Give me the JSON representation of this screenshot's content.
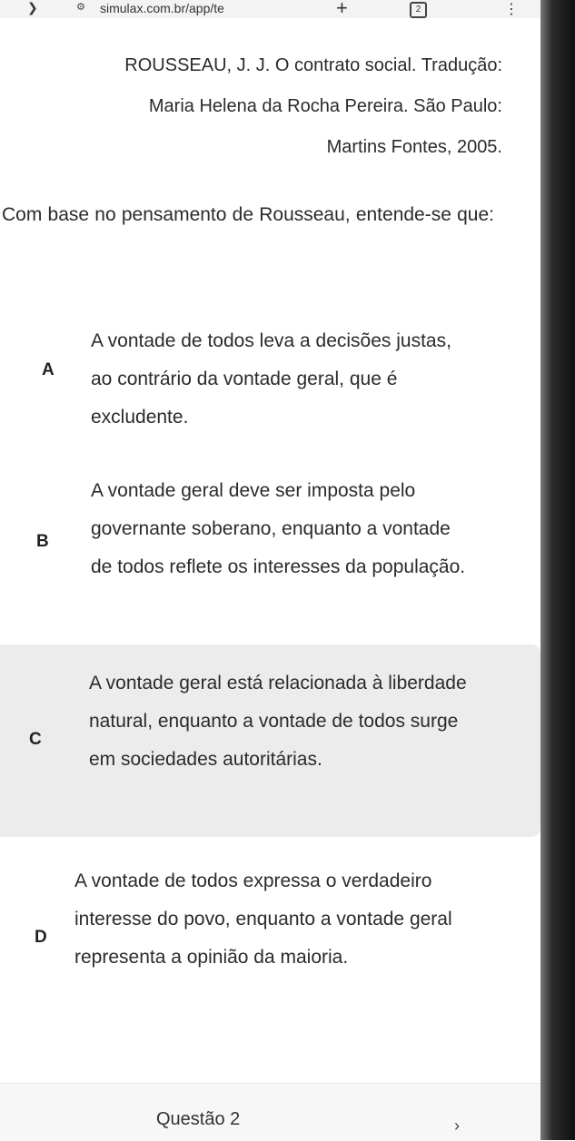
{
  "browser": {
    "back_icon": "back-arrow-icon",
    "site_icon_glyph": "⚙",
    "url": "simulax.com.br/app/te",
    "new_tab_glyph": "+",
    "tab_count": "2",
    "menu_glyph": "⋮"
  },
  "citation": {
    "line1": "ROUSSEAU, J. J. O contrato social. Tradução:",
    "line2": "Maria Helena da Rocha Pereira. São Paulo:",
    "line3": "Martins Fontes, 2005."
  },
  "question": {
    "text": "Com base no pensamento de Rousseau, entende-se que:"
  },
  "options": [
    {
      "letter": "A",
      "text": "A vontade de todos leva a decisões justas, ao contrário da vontade geral, que é excludente.",
      "selected": false
    },
    {
      "letter": "B",
      "text": "A vontade geral deve ser imposta pelo governante soberano, enquanto a vontade de todos reflete os interesses da população.",
      "selected": false
    },
    {
      "letter": "C",
      "text": "A vontade geral está relacionada à liberdade natural, enquanto a vontade de todos surge em sociedades autoritárias.",
      "selected": true
    },
    {
      "letter": "D",
      "text": "A vontade de todos expressa o verdadeiro interesse do povo, enquanto a vontade geral representa a opinião da maioria.",
      "selected": false
    }
  ],
  "footer": {
    "next_question_label": "Questão 2",
    "chevron_glyph": "›"
  },
  "colors": {
    "selected_bg": "#ececec",
    "text": "#2b2b2b",
    "background": "#ffffff"
  }
}
